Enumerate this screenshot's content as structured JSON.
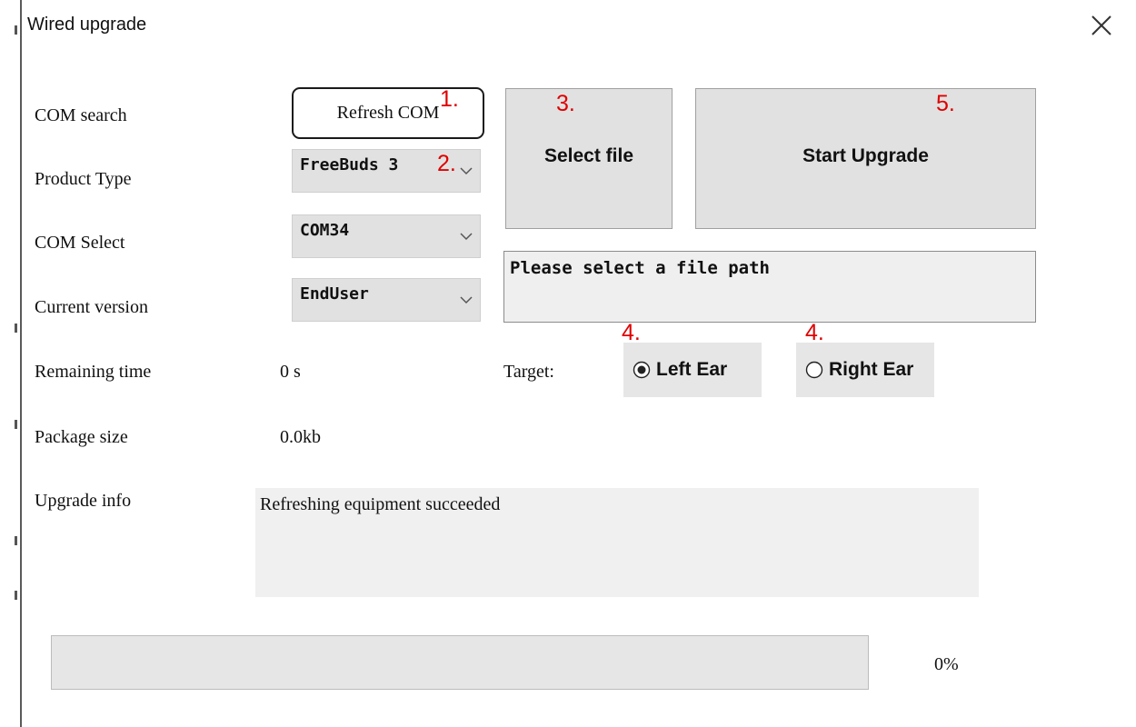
{
  "window": {
    "title": "Wired upgrade"
  },
  "labels": {
    "com_search": "COM search",
    "product_type": "Product Type",
    "com_select": "COM Select",
    "current_version": "Current version",
    "remaining_time": "Remaining time",
    "package_size": "Package size",
    "upgrade_info": "Upgrade info",
    "target": "Target:"
  },
  "buttons": {
    "refresh_com": "Refresh COM",
    "select_file": "Select file",
    "start_upgrade": "Start Upgrade"
  },
  "selects": {
    "product_type": "FreeBuds 3",
    "com_select": "COM34",
    "current_version": "EndUser"
  },
  "values": {
    "remaining_time": "0 s",
    "package_size": "0.0kb",
    "file_path": "Please select a file path",
    "upgrade_info": "Refreshing equipment succeeded",
    "progress_percent": 0,
    "progress_text": "0%"
  },
  "target": {
    "left_ear": "Left Ear",
    "right_ear": "Right Ear",
    "selected": "left"
  },
  "annotations": [
    "1.",
    "2.",
    "3.",
    "4.",
    "4.",
    "5."
  ],
  "colors": {
    "annotation": "#e00000",
    "control_bg": "#e1e1e1",
    "progress_fill": "#06b025"
  },
  "icons": {
    "close": "close-icon",
    "chevron": "chevron-down-icon",
    "radio": "radio-icon"
  }
}
